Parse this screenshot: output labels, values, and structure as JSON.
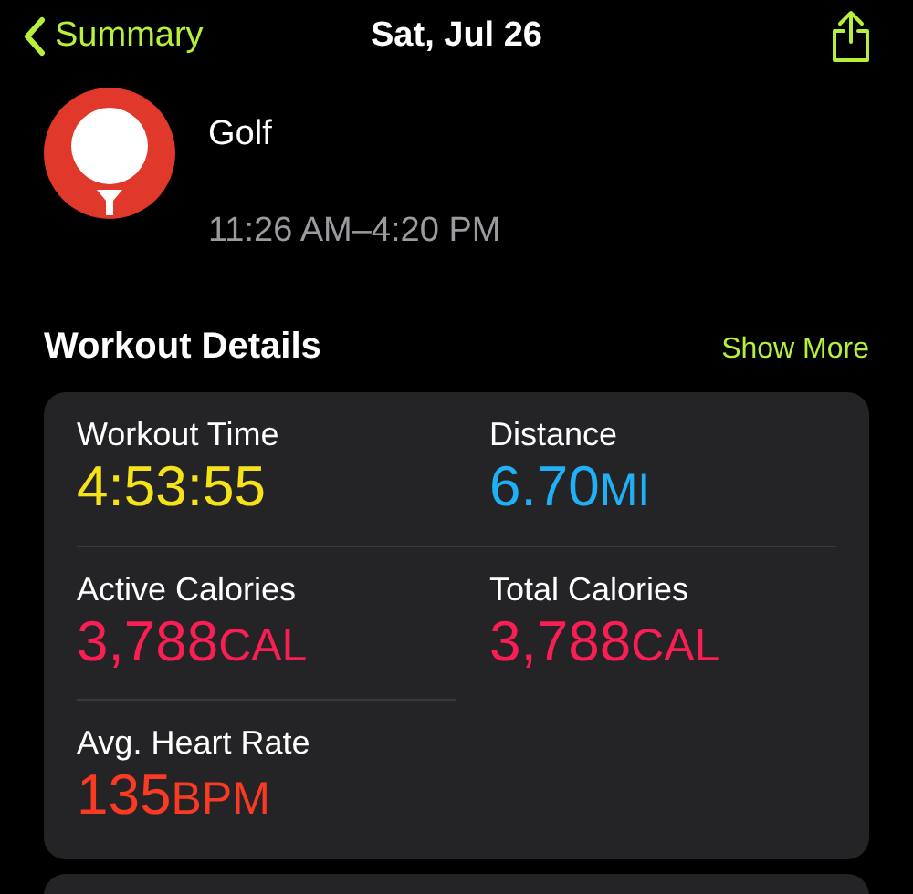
{
  "nav": {
    "back_label": "Summary",
    "title": "Sat, Jul 26"
  },
  "workout": {
    "name": "Golf",
    "time_range": "11:26 AM–4:20 PM"
  },
  "section": {
    "title": "Workout Details",
    "action": "Show More"
  },
  "metrics": [
    {
      "label": "Workout Time",
      "value": "4:53:55",
      "color": "#f5e31a"
    },
    {
      "label": "Distance",
      "value": "6.70",
      "unit": "MI",
      "color": "#1fb0f5"
    },
    {
      "label": "Active Calories",
      "value": "3,788",
      "unit": "CAL",
      "color": "#fa1e55"
    },
    {
      "label": "Total Calories",
      "value": "3,788",
      "unit": "CAL",
      "color": "#fa1e55"
    },
    {
      "label": "Avg. Heart Rate",
      "value": "135",
      "unit": "BPM",
      "color": "#fa3a22"
    }
  ]
}
